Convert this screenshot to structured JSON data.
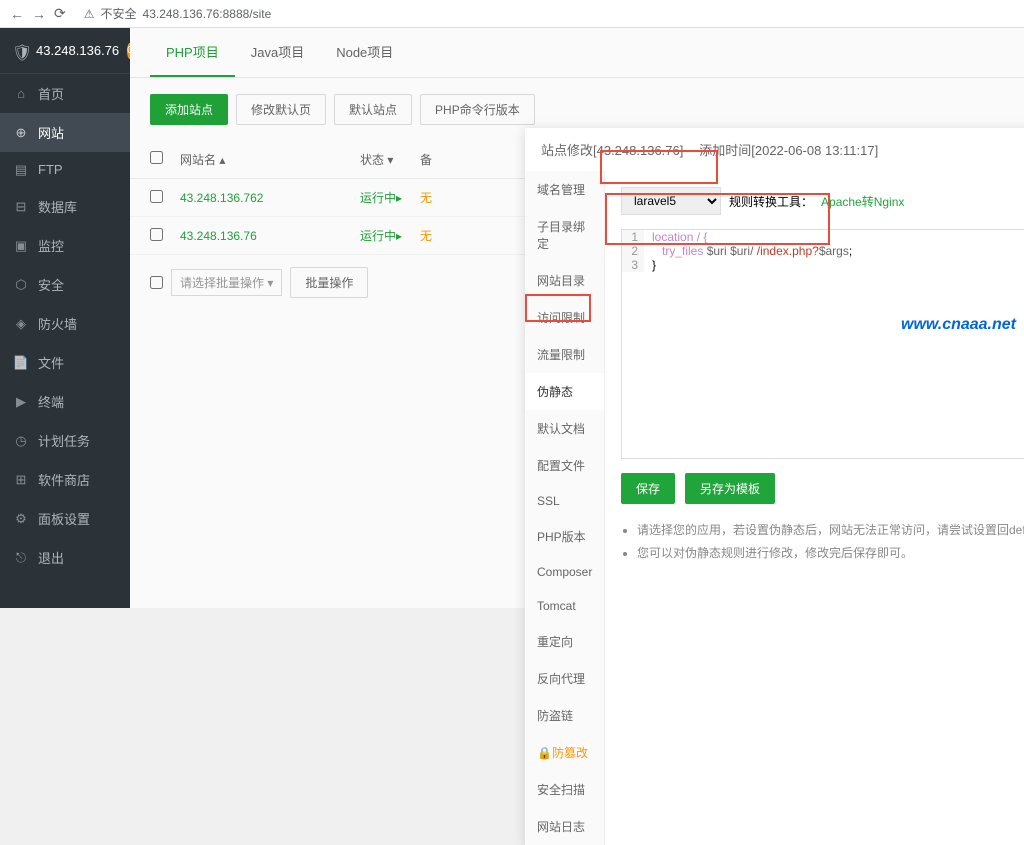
{
  "browser": {
    "url": "43.248.136.76:8888/site",
    "security": "不安全"
  },
  "sidebar": {
    "server_ip": "43.248.136.76",
    "badge": "0",
    "items": [
      {
        "icon": "home",
        "label": "首页"
      },
      {
        "icon": "globe",
        "label": "网站",
        "active": true
      },
      {
        "icon": "folder",
        "label": "FTP"
      },
      {
        "icon": "database",
        "label": "数据库"
      },
      {
        "icon": "monitor",
        "label": "监控"
      },
      {
        "icon": "shield",
        "label": "安全"
      },
      {
        "icon": "firewall",
        "label": "防火墙"
      },
      {
        "icon": "file",
        "label": "文件"
      },
      {
        "icon": "terminal",
        "label": "终端"
      },
      {
        "icon": "clock",
        "label": "计划任务"
      },
      {
        "icon": "grid",
        "label": "软件商店"
      },
      {
        "icon": "settings",
        "label": "面板设置"
      },
      {
        "icon": "logout",
        "label": "退出"
      }
    ]
  },
  "tabs": [
    {
      "label": "PHP项目",
      "active": true
    },
    {
      "label": "Java项目"
    },
    {
      "label": "Node项目"
    }
  ],
  "toolbar": {
    "add_site": "添加站点",
    "edit_default": "修改默认页",
    "default_site": "默认站点",
    "php_cli": "PHP命令行版本"
  },
  "table": {
    "headers": {
      "domain": "网站名",
      "status": "状态",
      "backup": "备"
    },
    "rows": [
      {
        "domain": "43.248.136.762",
        "status": "运行中",
        "backup": "无"
      },
      {
        "domain": "43.248.136.76",
        "status": "运行中",
        "backup": "无"
      }
    ]
  },
  "bulk": {
    "placeholder": "请选择批量操作",
    "btn": "批量操作"
  },
  "modal": {
    "title": "站点修改[43.248.136.76] -- 添加时间[2022-06-08 13:11:17]",
    "side": [
      "域名管理",
      "子目录绑定",
      "网站目录",
      "访问限制",
      "流量限制",
      "伪静态",
      "默认文档",
      "配置文件",
      "SSL",
      "PHP版本",
      "Composer",
      "Tomcat",
      "重定向",
      "反向代理",
      "防盗链",
      "防篡改",
      "安全扫描",
      "网站日志"
    ],
    "side_active": "伪静态",
    "side_warn": "防篡改",
    "select_value": "laravel5",
    "tool_label": "规则转换工具：",
    "tool_link": "Apache转Nginx",
    "code": {
      "l1": "location / {",
      "l2_kw": "try_files",
      "l2_v1": "$uri",
      "l2_v2": "$uri/",
      "l2_str": "/index.php?",
      "l2_arg": "$args",
      "l3": "}"
    },
    "save": "保存",
    "save_as": "另存为模板",
    "notes": [
      "请选择您的应用，若设置伪静态后，网站无法正常访问，请尝试设置回default",
      "您可以对伪静态规则进行修改，修改完后保存即可。"
    ]
  },
  "watermark": "www.cnaaa.net"
}
